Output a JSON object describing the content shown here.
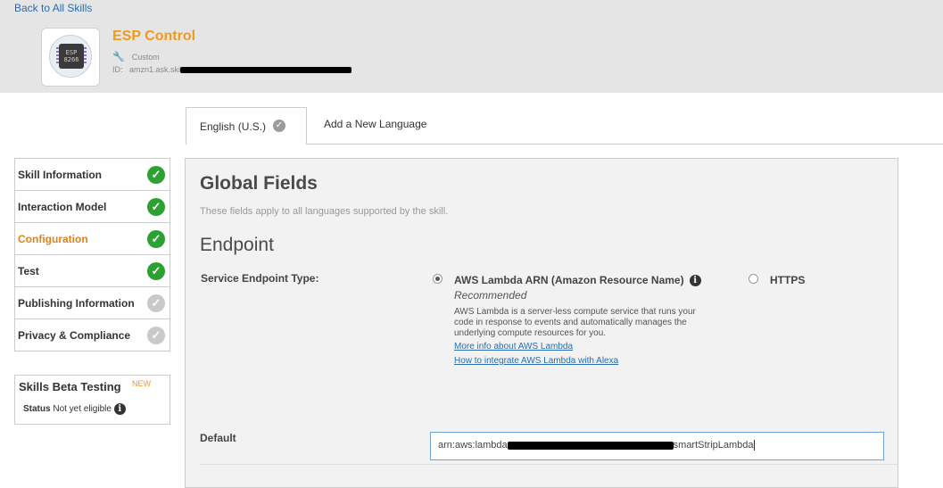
{
  "header": {
    "back_link": "Back to All Skills",
    "skill_name": "ESP Control",
    "skill_type": "Custom",
    "id_label": "ID:",
    "id_value": "amzn1.ask.ski",
    "chip_text": "ESP 8266"
  },
  "tabs": {
    "active_label": "English (U.S.)",
    "add_label": "Add a New Language"
  },
  "steps": [
    {
      "label": "Skill Information",
      "status": "complete"
    },
    {
      "label": "Interaction Model",
      "status": "complete"
    },
    {
      "label": "Configuration",
      "status": "complete",
      "active": true
    },
    {
      "label": "Test",
      "status": "complete"
    },
    {
      "label": "Publishing Information",
      "status": "incomplete"
    },
    {
      "label": "Privacy & Compliance",
      "status": "incomplete"
    }
  ],
  "beta": {
    "title": "Skills Beta Testing",
    "badge": "NEW",
    "status_label": "Status",
    "status_value": "Not yet eligible"
  },
  "panel": {
    "title": "Global Fields",
    "subtitle": "These fields apply to all languages supported by the skill.",
    "endpoint_heading": "Endpoint",
    "service_label": "Service Endpoint Type:",
    "lambda_option": "AWS Lambda ARN (Amazon Resource Name)",
    "lambda_recommended": "Recommended",
    "lambda_description": "AWS Lambda is a server-less compute service that runs your code in response to events and automatically manages the underlying compute resources for you.",
    "link_more": "More info about AWS Lambda",
    "link_howto": "How to integrate AWS Lambda with Alexa",
    "https_option": "HTTPS",
    "selected_option": "AWS Lambda ARN",
    "default_label": "Default",
    "arn_prefix": "arn:aws:lambda",
    "arn_suffix": "smartStripLambda"
  },
  "colors": {
    "accent_orange": "#f09a19",
    "link_blue": "#2a6db0",
    "check_green": "#2aa131",
    "check_gray": "#c9c9c9"
  }
}
